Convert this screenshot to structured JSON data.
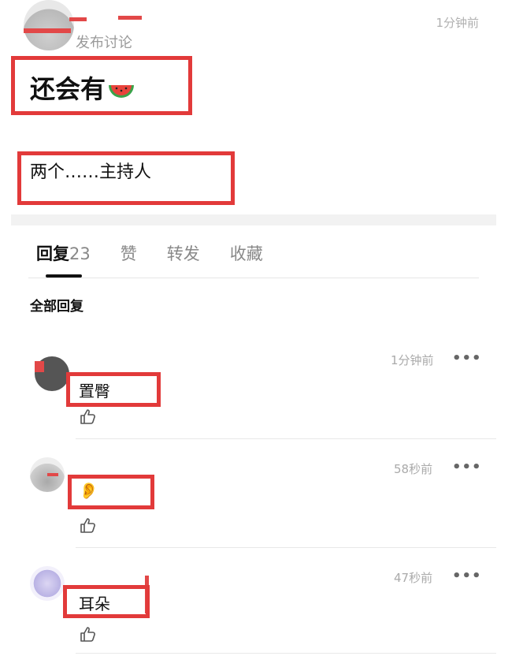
{
  "post": {
    "subtitle": "发布讨论",
    "time": "1分钟前",
    "title": "还会有",
    "body": "两个……主持人"
  },
  "tabs": [
    {
      "label": "回复",
      "count": "23",
      "active": true
    },
    {
      "label": "赞"
    },
    {
      "label": "转发"
    },
    {
      "label": "收藏"
    }
  ],
  "section_title": "全部回复",
  "replies": [
    {
      "time": "1分钟前",
      "text": "置臀",
      "more": "•••"
    },
    {
      "time": "58秒前",
      "text": "👂",
      "more": "•••"
    },
    {
      "time": "47秒前",
      "text": "耳朵",
      "more": "•••"
    }
  ],
  "colors": {
    "highlight": "#e23a3a",
    "muted": "#aaaaaa"
  },
  "icons": [
    "watermelon-emoji",
    "thumbs-up-icon",
    "more-dots-icon",
    "ear-emoji"
  ]
}
